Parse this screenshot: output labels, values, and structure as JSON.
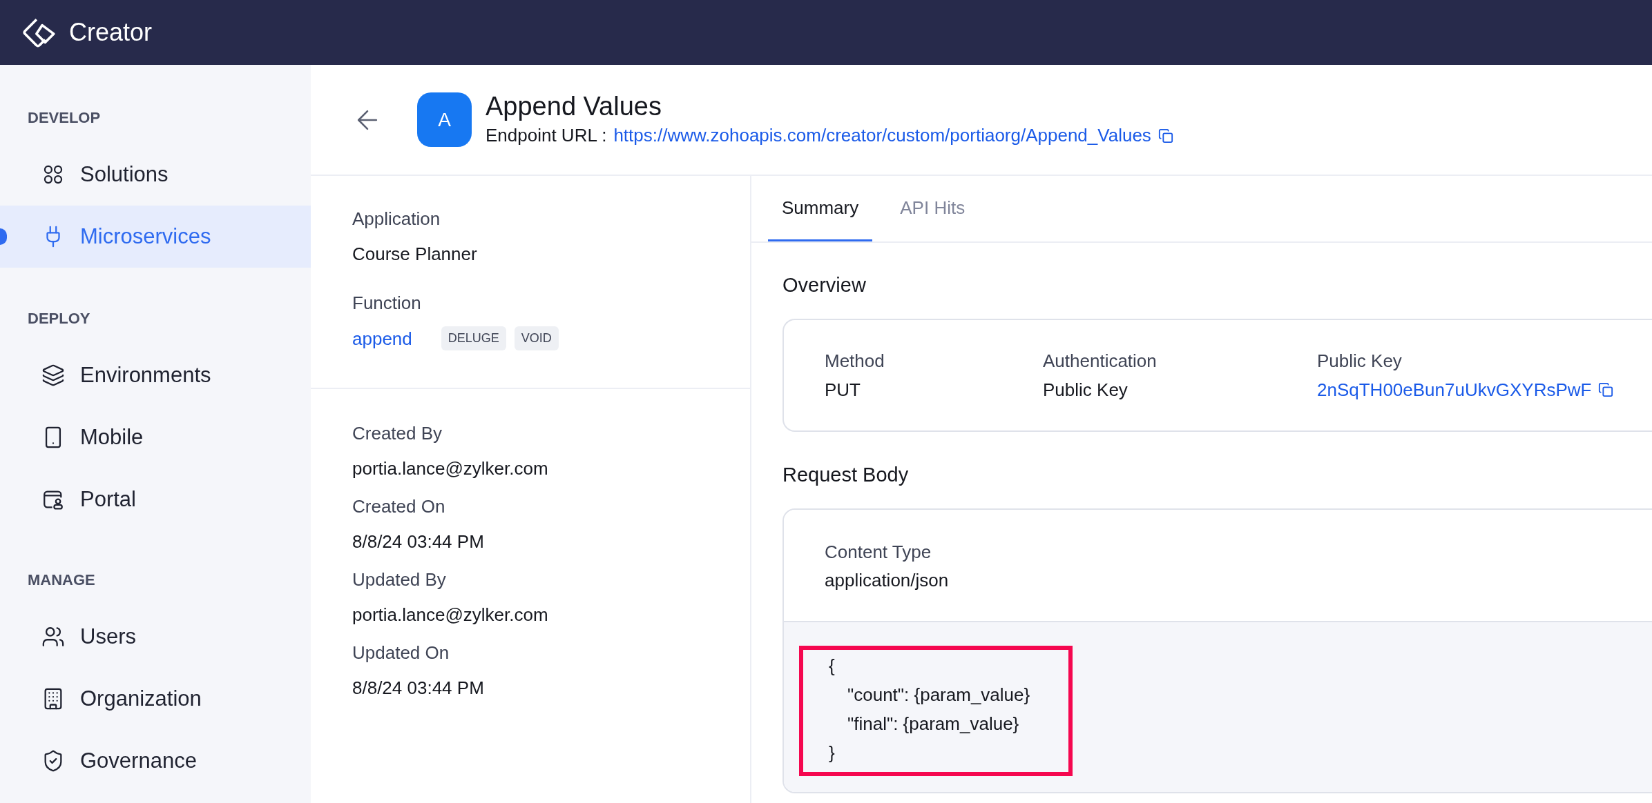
{
  "app_bar": {
    "product_name": "Creator"
  },
  "sidebar": {
    "sections": [
      {
        "title": "DEVELOP",
        "items": [
          {
            "label": "Solutions",
            "selected": false
          },
          {
            "label": "Microservices",
            "selected": true
          }
        ]
      },
      {
        "title": "DEPLOY",
        "items": [
          {
            "label": "Environments",
            "selected": false
          },
          {
            "label": "Mobile",
            "selected": false
          },
          {
            "label": "Portal",
            "selected": false
          }
        ]
      },
      {
        "title": "MANAGE",
        "items": [
          {
            "label": "Users",
            "selected": false
          },
          {
            "label": "Organization",
            "selected": false
          },
          {
            "label": "Governance",
            "selected": false
          }
        ]
      }
    ]
  },
  "page_header": {
    "avatar_letter": "A",
    "title": "Append Values",
    "endpoint_label": "Endpoint URL :",
    "endpoint_url": "https://www.zohoapis.com/creator/custom/portiaorg/Append_Values"
  },
  "details": {
    "application": {
      "label": "Application",
      "value": "Course Planner"
    },
    "function": {
      "label": "Function",
      "value": "append",
      "tags": [
        "DELUGE",
        "VOID"
      ]
    },
    "meta": [
      {
        "label": "Created By",
        "value": "portia.lance@zylker.com"
      },
      {
        "label": "Created On",
        "value": "8/8/24 03:44 PM"
      },
      {
        "label": "Updated By",
        "value": "portia.lance@zylker.com"
      },
      {
        "label": "Updated On",
        "value": "8/8/24 03:44 PM"
      }
    ]
  },
  "tabs": [
    {
      "label": "Summary",
      "selected": true
    },
    {
      "label": "API Hits",
      "selected": false
    }
  ],
  "overview": {
    "title": "Overview",
    "fields": [
      {
        "label": "Method",
        "value": "PUT",
        "kind": "text"
      },
      {
        "label": "Authentication",
        "value": "Public Key",
        "kind": "text"
      },
      {
        "label": "Public Key",
        "value": "2nSqTH00eBun7uUkvGXYRsPwF",
        "kind": "link"
      }
    ]
  },
  "request_body": {
    "title": "Request Body",
    "content_type_label": "Content Type",
    "content_type": "application/json",
    "highlighted": true,
    "code": {
      "open": "{",
      "entries": [
        "\"count\": {param_value}",
        "\"final\": {param_value}"
      ],
      "close": "}"
    }
  }
}
